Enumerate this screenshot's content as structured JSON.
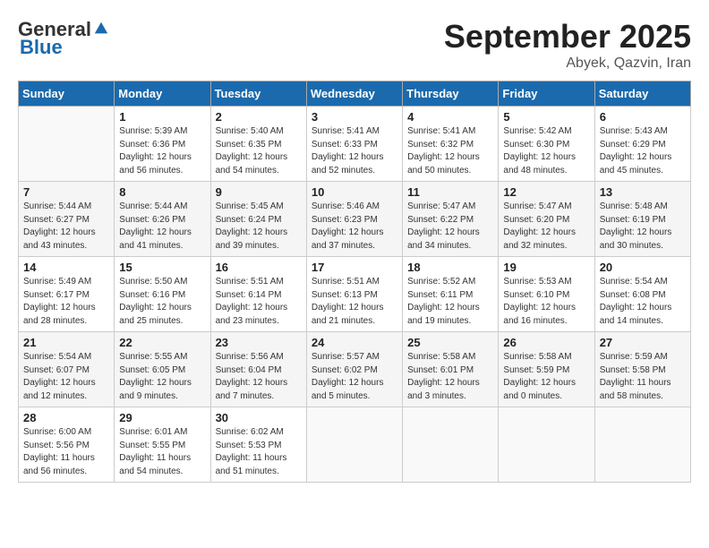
{
  "logo": {
    "general": "General",
    "blue": "Blue"
  },
  "title": "September 2025",
  "location": "Abyek, Qazvin, Iran",
  "days_of_week": [
    "Sunday",
    "Monday",
    "Tuesday",
    "Wednesday",
    "Thursday",
    "Friday",
    "Saturday"
  ],
  "weeks": [
    [
      {
        "day": "",
        "info": ""
      },
      {
        "day": "1",
        "info": "Sunrise: 5:39 AM\nSunset: 6:36 PM\nDaylight: 12 hours\nand 56 minutes."
      },
      {
        "day": "2",
        "info": "Sunrise: 5:40 AM\nSunset: 6:35 PM\nDaylight: 12 hours\nand 54 minutes."
      },
      {
        "day": "3",
        "info": "Sunrise: 5:41 AM\nSunset: 6:33 PM\nDaylight: 12 hours\nand 52 minutes."
      },
      {
        "day": "4",
        "info": "Sunrise: 5:41 AM\nSunset: 6:32 PM\nDaylight: 12 hours\nand 50 minutes."
      },
      {
        "day": "5",
        "info": "Sunrise: 5:42 AM\nSunset: 6:30 PM\nDaylight: 12 hours\nand 48 minutes."
      },
      {
        "day": "6",
        "info": "Sunrise: 5:43 AM\nSunset: 6:29 PM\nDaylight: 12 hours\nand 45 minutes."
      }
    ],
    [
      {
        "day": "7",
        "info": "Sunrise: 5:44 AM\nSunset: 6:27 PM\nDaylight: 12 hours\nand 43 minutes."
      },
      {
        "day": "8",
        "info": "Sunrise: 5:44 AM\nSunset: 6:26 PM\nDaylight: 12 hours\nand 41 minutes."
      },
      {
        "day": "9",
        "info": "Sunrise: 5:45 AM\nSunset: 6:24 PM\nDaylight: 12 hours\nand 39 minutes."
      },
      {
        "day": "10",
        "info": "Sunrise: 5:46 AM\nSunset: 6:23 PM\nDaylight: 12 hours\nand 37 minutes."
      },
      {
        "day": "11",
        "info": "Sunrise: 5:47 AM\nSunset: 6:22 PM\nDaylight: 12 hours\nand 34 minutes."
      },
      {
        "day": "12",
        "info": "Sunrise: 5:47 AM\nSunset: 6:20 PM\nDaylight: 12 hours\nand 32 minutes."
      },
      {
        "day": "13",
        "info": "Sunrise: 5:48 AM\nSunset: 6:19 PM\nDaylight: 12 hours\nand 30 minutes."
      }
    ],
    [
      {
        "day": "14",
        "info": "Sunrise: 5:49 AM\nSunset: 6:17 PM\nDaylight: 12 hours\nand 28 minutes."
      },
      {
        "day": "15",
        "info": "Sunrise: 5:50 AM\nSunset: 6:16 PM\nDaylight: 12 hours\nand 25 minutes."
      },
      {
        "day": "16",
        "info": "Sunrise: 5:51 AM\nSunset: 6:14 PM\nDaylight: 12 hours\nand 23 minutes."
      },
      {
        "day": "17",
        "info": "Sunrise: 5:51 AM\nSunset: 6:13 PM\nDaylight: 12 hours\nand 21 minutes."
      },
      {
        "day": "18",
        "info": "Sunrise: 5:52 AM\nSunset: 6:11 PM\nDaylight: 12 hours\nand 19 minutes."
      },
      {
        "day": "19",
        "info": "Sunrise: 5:53 AM\nSunset: 6:10 PM\nDaylight: 12 hours\nand 16 minutes."
      },
      {
        "day": "20",
        "info": "Sunrise: 5:54 AM\nSunset: 6:08 PM\nDaylight: 12 hours\nand 14 minutes."
      }
    ],
    [
      {
        "day": "21",
        "info": "Sunrise: 5:54 AM\nSunset: 6:07 PM\nDaylight: 12 hours\nand 12 minutes."
      },
      {
        "day": "22",
        "info": "Sunrise: 5:55 AM\nSunset: 6:05 PM\nDaylight: 12 hours\nand 9 minutes."
      },
      {
        "day": "23",
        "info": "Sunrise: 5:56 AM\nSunset: 6:04 PM\nDaylight: 12 hours\nand 7 minutes."
      },
      {
        "day": "24",
        "info": "Sunrise: 5:57 AM\nSunset: 6:02 PM\nDaylight: 12 hours\nand 5 minutes."
      },
      {
        "day": "25",
        "info": "Sunrise: 5:58 AM\nSunset: 6:01 PM\nDaylight: 12 hours\nand 3 minutes."
      },
      {
        "day": "26",
        "info": "Sunrise: 5:58 AM\nSunset: 5:59 PM\nDaylight: 12 hours\nand 0 minutes."
      },
      {
        "day": "27",
        "info": "Sunrise: 5:59 AM\nSunset: 5:58 PM\nDaylight: 11 hours\nand 58 minutes."
      }
    ],
    [
      {
        "day": "28",
        "info": "Sunrise: 6:00 AM\nSunset: 5:56 PM\nDaylight: 11 hours\nand 56 minutes."
      },
      {
        "day": "29",
        "info": "Sunrise: 6:01 AM\nSunset: 5:55 PM\nDaylight: 11 hours\nand 54 minutes."
      },
      {
        "day": "30",
        "info": "Sunrise: 6:02 AM\nSunset: 5:53 PM\nDaylight: 11 hours\nand 51 minutes."
      },
      {
        "day": "",
        "info": ""
      },
      {
        "day": "",
        "info": ""
      },
      {
        "day": "",
        "info": ""
      },
      {
        "day": "",
        "info": ""
      }
    ]
  ]
}
